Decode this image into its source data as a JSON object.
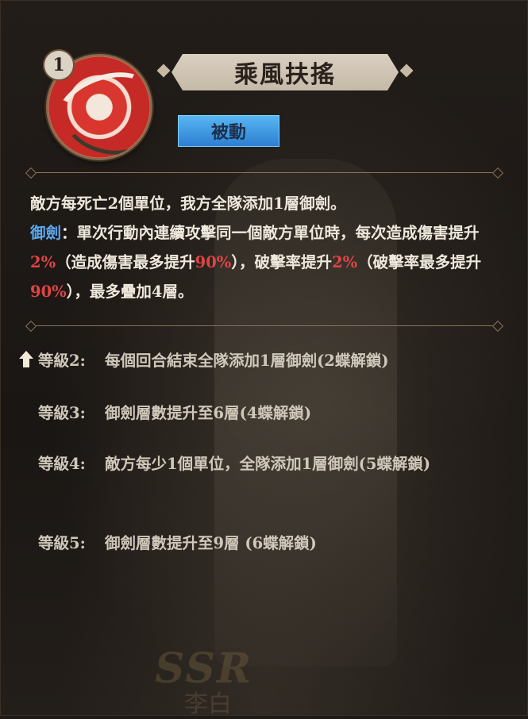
{
  "skill": {
    "level": "1",
    "title": "乘風扶搖",
    "type": "被動"
  },
  "description": {
    "line1": "敵方每死亡2個單位，我方全隊添加1層御劍。",
    "keyword": "御劍",
    "colon": "：",
    "p1": "單次行動內連續攻擊同一個敵方單位時，每次造成傷害提升",
    "v1": "2%",
    "p2": "（造成傷害最多提升",
    "v2": "90%",
    "p3": "），破擊率提升",
    "v3": "2%",
    "p4": "（破擊率最多提升",
    "v4": "90%",
    "p5": "），最多疊加4層。"
  },
  "levels": [
    {
      "label": "等級2:",
      "text": "每個回合結束全隊添加1層御劍(2蝶解鎖)"
    },
    {
      "label": "等級3:",
      "text": "御劍層數提升至6層(4蝶解鎖)"
    },
    {
      "label": "等級4:",
      "text": "敵方每少1個單位，全隊添加1層御劍(5蝶解鎖)"
    },
    {
      "label": "等級5:",
      "text": "御劍層數提升至9層 (6蝶解鎖)"
    }
  ],
  "watermark": {
    "rarity": "SSR",
    "name": "李白"
  },
  "colors": {
    "keyword": "#5aa9ef",
    "highlight": "#e04444",
    "passive_badge": "#3a94e0"
  }
}
